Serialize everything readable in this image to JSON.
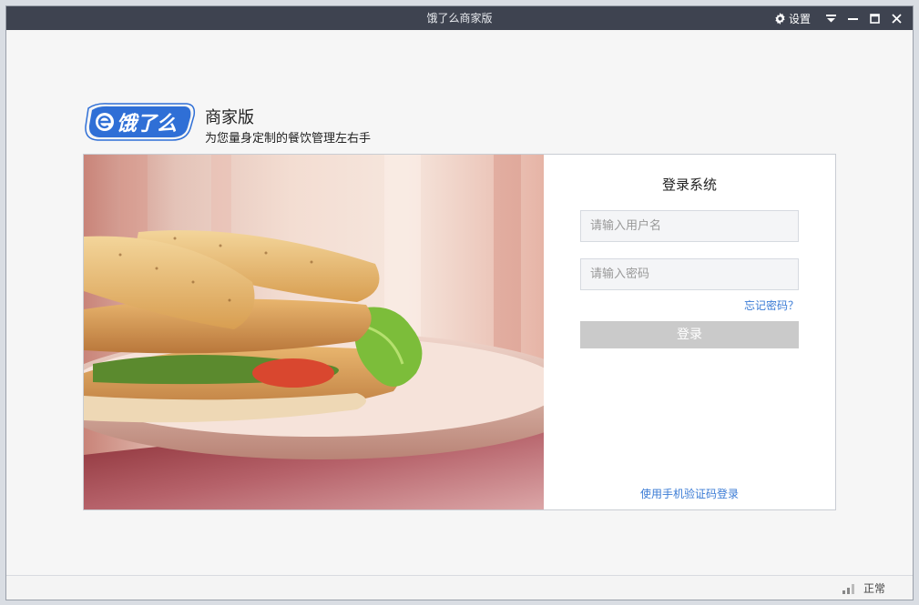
{
  "window": {
    "title": "饿了么商家版",
    "settings_label": "设置"
  },
  "header": {
    "logo_text": "饿了么",
    "brand_title": "商家版",
    "brand_subtitle": "为您量身定制的餐饮管理左右手"
  },
  "login": {
    "title": "登录系统",
    "username_placeholder": "请输入用户名",
    "password_placeholder": "请输入密码",
    "forgot_label": "忘记密码？",
    "login_label": "登录",
    "sms_login_label": "使用手机验证码登录"
  },
  "status": {
    "connection_label": "正常"
  },
  "colors": {
    "titlebar": "#3e4350",
    "accent": "#3a7bd5",
    "login_button": "#cacaca"
  },
  "icons": [
    "gear-icon",
    "dropdown-icon",
    "minimize-icon",
    "maximize-icon",
    "close-icon",
    "signal-icon"
  ]
}
